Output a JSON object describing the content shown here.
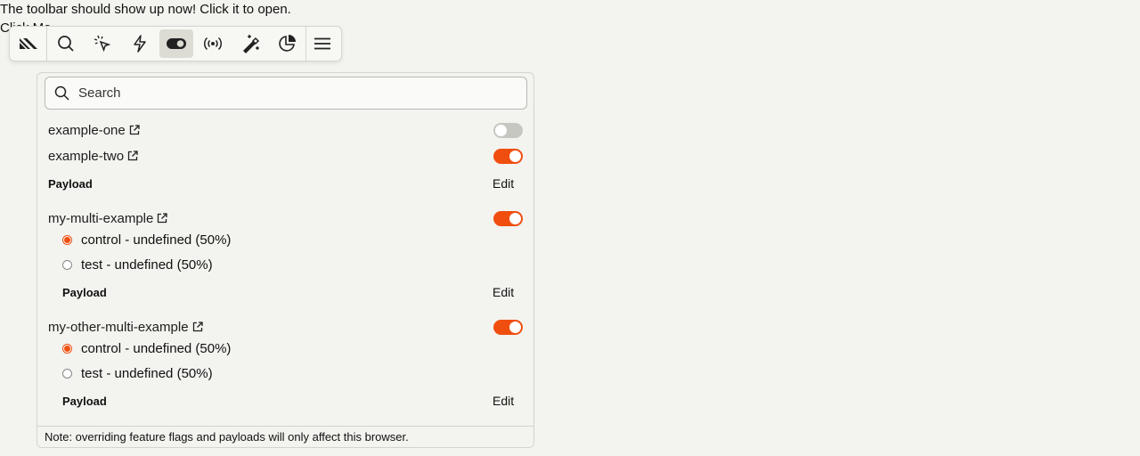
{
  "page": {
    "intro_text": "The toolbar should show up now! Click it to open.",
    "intro_text_2": "Click Me"
  },
  "toolbar": {
    "items": [
      {
        "icon": "posthog-logo-icon"
      },
      {
        "icon": "search-icon"
      },
      {
        "icon": "pointer-click-icon"
      },
      {
        "icon": "lightning-icon"
      },
      {
        "icon": "toggle-icon"
      },
      {
        "icon": "broadcast-icon"
      },
      {
        "icon": "magic-wand-icon"
      },
      {
        "icon": "pie-chart-icon"
      },
      {
        "icon": "menu-icon"
      }
    ],
    "active_item": "toggle-icon"
  },
  "panel": {
    "search_placeholder": "Search",
    "flags": [
      {
        "name": "example-one",
        "enabled": false
      },
      {
        "name": "example-two",
        "enabled": true,
        "payload_label": "Payload",
        "edit_label": "Edit"
      },
      {
        "name": "my-multi-example",
        "enabled": true,
        "variants": [
          {
            "label": "control - undefined (50%)",
            "selected": true
          },
          {
            "label": "test - undefined (50%)",
            "selected": false
          }
        ],
        "payload_label": "Payload",
        "edit_label": "Edit"
      },
      {
        "name": "my-other-multi-example",
        "enabled": true,
        "variants": [
          {
            "label": "control - undefined (50%)",
            "selected": true
          },
          {
            "label": "test - undefined (50%)",
            "selected": false
          }
        ],
        "payload_label": "Payload",
        "edit_label": "Edit"
      }
    ],
    "note": "Note: overriding feature flags and payloads will only affect this browser."
  },
  "colors": {
    "accent": "#f04e0f",
    "toggle_off": "#c7c7c2",
    "background": "#f3f3ef"
  }
}
